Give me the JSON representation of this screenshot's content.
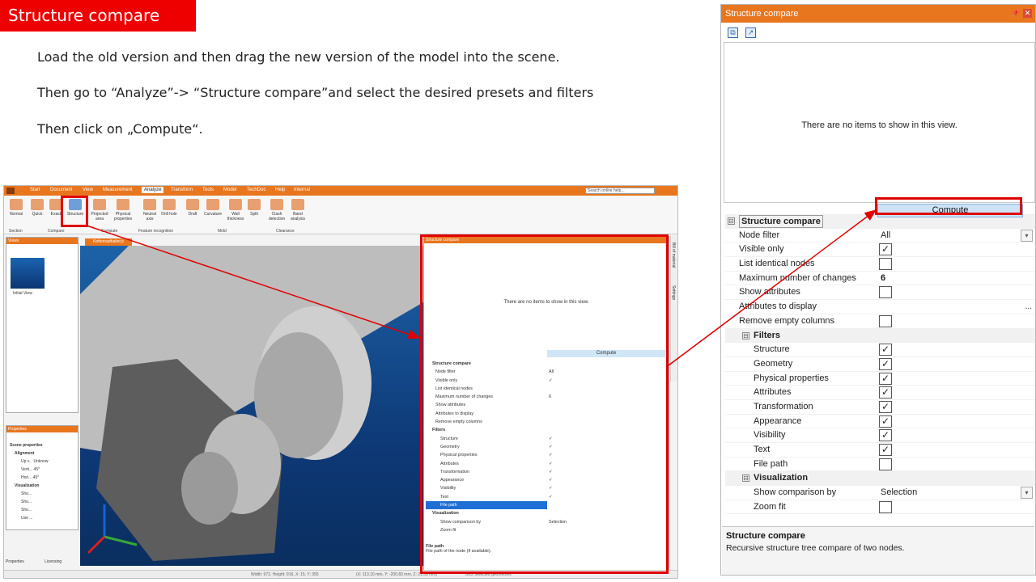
{
  "slide": {
    "title": "Structure compare",
    "instructions": [
      "Load the old version and then drag the new version of the model into the scene.",
      "Then go to “Analyze”-> “Structure compare”and select the desired presets and filters",
      "Then click on „Compute“."
    ]
  },
  "mini_app": {
    "tabs": [
      "Start",
      "Document",
      "View",
      "Measurement",
      "Analyze",
      "Transform",
      "Tools",
      "Model",
      "TechDoc",
      "Help",
      "Internal"
    ],
    "active_tab": "Analyze",
    "search_placeholder": "Search online help...",
    "ribbon_buttons": [
      "Normal",
      "Quick",
      "Exact",
      "Structure",
      "Projected area",
      "Physical properties",
      "Neutral axis",
      "Drill hole",
      "Draft",
      "Curvature",
      "Wall thickness",
      "Split",
      "Clash detection",
      "Band analysis"
    ],
    "ribbon_groups": [
      "Section",
      "Compare",
      "Compute",
      "Feature recognition",
      "Mold",
      "Clearance"
    ],
    "views_title": "Views",
    "initial_view": "Initial View",
    "properties_title": "Properties",
    "props": [
      "Scene properties",
      "Alignment",
      "Up v...  Unknow",
      "Verti...  45°",
      "Hori...  45°",
      "Visualization",
      "Sho...",
      "Sho...",
      "Sho...",
      "Use ..."
    ],
    "bottom_tabs": [
      "Properties",
      "Licensing"
    ],
    "viewport_tab": "Kettenradhalter.jt",
    "side_tabs": [
      "Bill of material",
      "Settings"
    ],
    "panel_title": "Structure compare",
    "empty": "There are no items to show in this view.",
    "compute": "Compute",
    "rows": [
      {
        "label": "Structure compare",
        "kind": "sec"
      },
      {
        "label": "Node filter",
        "value": "All"
      },
      {
        "label": "Visible only",
        "value": "✓"
      },
      {
        "label": "List identical nodes",
        "value": ""
      },
      {
        "label": "Maximum number of changes",
        "value": "6"
      },
      {
        "label": "Show attributes",
        "value": ""
      },
      {
        "label": "Attributes to display",
        "value": ""
      },
      {
        "label": "Remove empty columns",
        "value": ""
      },
      {
        "label": "Filters",
        "kind": "sec"
      },
      {
        "label": "Structure",
        "value": "✓"
      },
      {
        "label": "Geometry",
        "value": "✓"
      },
      {
        "label": "Physical properties",
        "value": "✓"
      },
      {
        "label": "Attributes",
        "value": "✓"
      },
      {
        "label": "Transformation",
        "value": "✓"
      },
      {
        "label": "Appearance",
        "value": "✓"
      },
      {
        "label": "Visibility",
        "value": "✓"
      },
      {
        "label": "Text",
        "value": "✓"
      },
      {
        "label": "File path",
        "value": "",
        "highlight": true
      },
      {
        "label": "Visualization",
        "kind": "sec"
      },
      {
        "label": "Show comparison by",
        "value": "Selection"
      },
      {
        "label": "Zoom fit",
        "value": ""
      }
    ],
    "desc_title": "File path",
    "desc_body": "File path of the node (if available).",
    "status": [
      "Width: 972, Height: 916, X: 15, Y: 355",
      "(X: 113.10 mm, Y: -200.83 mm, Z: 21.39 mm)",
      "0/22 Selected geometries"
    ]
  },
  "panel": {
    "title": "Structure compare",
    "empty_message": "There are no items to show in this view.",
    "compute_label": "Compute",
    "section_main": "Structure compare",
    "node_filter_label": "Node filter",
    "node_filter_value": "All",
    "visible_only_label": "Visible only",
    "list_identical_label": "List identical nodes",
    "max_changes_label": "Maximum number of changes",
    "max_changes_value": "6",
    "show_attributes_label": "Show attributes",
    "attributes_display_label": "Attributes to display",
    "attributes_display_button": "...",
    "remove_empty_label": "Remove empty columns",
    "section_filters": "Filters",
    "filters": [
      {
        "label": "Structure",
        "checked": true
      },
      {
        "label": "Geometry",
        "checked": true
      },
      {
        "label": "Physical properties",
        "checked": true
      },
      {
        "label": "Attributes",
        "checked": true
      },
      {
        "label": "Transformation",
        "checked": true
      },
      {
        "label": "Appearance",
        "checked": true
      },
      {
        "label": "Visibility",
        "checked": true
      },
      {
        "label": "Text",
        "checked": true
      },
      {
        "label": "File path",
        "checked": false
      }
    ],
    "section_visualization": "Visualization",
    "show_comparison_label": "Show comparison by",
    "show_comparison_value": "Selection",
    "zoom_fit_label": "Zoom fit",
    "desc_title": "Structure compare",
    "desc_body": "Recursive structure tree compare of two nodes.",
    "check_mark": "✓",
    "expand_symbol": "⊟"
  },
  "colors": {
    "accent": "#e8761f",
    "highlight": "#e00000",
    "compute_bg": "#cde3f5"
  }
}
